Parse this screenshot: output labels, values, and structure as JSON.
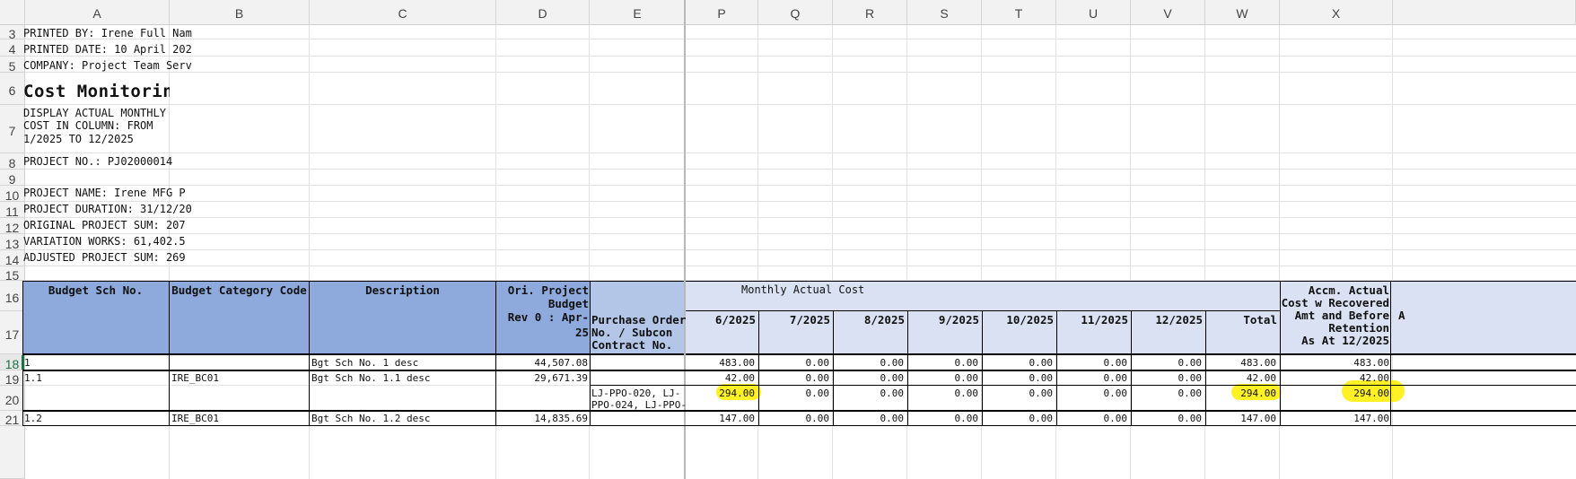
{
  "columns": [
    "A",
    "B",
    "C",
    "D",
    "E",
    "P",
    "Q",
    "R",
    "S",
    "T",
    "U",
    "V",
    "W",
    "X"
  ],
  "rows": [
    "3",
    "4",
    "5",
    "6",
    "7",
    "8",
    "9",
    "10",
    "11",
    "12",
    "13",
    "14",
    "15",
    "16",
    "17",
    "18",
    "19",
    "20",
    "21"
  ],
  "header_info": {
    "printed_by": "PRINTED BY: Irene Full Nam",
    "printed_date": "PRINTED DATE: 10 April 202",
    "company": "COMPANY: Project Team Serv",
    "report_title": "Cost Monitoring R",
    "display_line1": "DISPLAY ACTUAL MONTHLY",
    "display_line2": "COST IN COLUMN: FROM",
    "display_line3": "1/2025 TO 12/2025",
    "project_no": "PROJECT NO.: PJ02000014",
    "project_name": "PROJECT NAME:  Irene MFG P",
    "project_duration": "PROJECT DURATION: 31/12/20",
    "original_sum": "ORIGINAL PROJECT SUM:  207",
    "variation_works": "VARIATION WORKS:  61,402.5",
    "adjusted_sum": "ADJUSTED PROJECT SUM:  269"
  },
  "table_header": {
    "budget_sch_no": "Budget Sch No.",
    "budget_category_code": "Budget Category Code",
    "description": "Description",
    "ori_budget_l1": "Ori. Project",
    "ori_budget_l2": "Budget",
    "ori_budget_l3": "Rev 0 : Apr-25",
    "po_l1": "Purchase Order",
    "po_l2": "No. / Subcon",
    "po_l3": "Contract No.",
    "monthly_actual_cost": "Monthly Actual Cost",
    "months": [
      "6/2025",
      "7/2025",
      "8/2025",
      "9/2025",
      "10/2025",
      "11/2025",
      "12/2025",
      "Total"
    ],
    "accm_l1": "Accm. Actual",
    "accm_l2": "Cost w Recovered",
    "accm_l3": "Amt and Before",
    "accm_l4": "Retention",
    "accm_l5": "As At 12/2025",
    "cut_letter": "A"
  },
  "data_rows": [
    {
      "sch": "1",
      "code": "",
      "desc": "Bgt Sch No. 1 desc",
      "budget": "44,507.08",
      "po1": "",
      "po2": "",
      "vals": [
        "483.00",
        "0.00",
        "0.00",
        "0.00",
        "0.00",
        "0.00",
        "0.00",
        "483.00",
        "483.00"
      ]
    },
    {
      "sch": "1.1",
      "code": "IRE_BC01",
      "desc": "Bgt Sch No. 1.1 desc",
      "budget": "29,671.39",
      "po1": "",
      "po2": "",
      "vals": [
        "42.00",
        "0.00",
        "0.00",
        "0.00",
        "0.00",
        "0.00",
        "0.00",
        "42.00",
        "42.00"
      ]
    },
    {
      "sch": "",
      "code": "",
      "desc": "",
      "budget": "",
      "po1": "LJ-PPO-020, LJ-",
      "po2": "PPO-024, LJ-PPO-",
      "vals": [
        "294.00",
        "0.00",
        "0.00",
        "0.00",
        "0.00",
        "0.00",
        "0.00",
        "294.00",
        "294.00"
      ]
    },
    {
      "sch": "1.2",
      "code": "IRE_BC01",
      "desc": "Bgt Sch No. 1.2 desc",
      "budget": "14,835.69",
      "po1": "",
      "po2": "",
      "vals": [
        "147.00",
        "0.00",
        "0.00",
        "0.00",
        "0.00",
        "0.00",
        "0.00",
        "147.00",
        "147.00"
      ]
    }
  ],
  "colors": {
    "header_blue": "#8ea9db",
    "header_light": "#b4c6e7",
    "header_pale": "#d9e1f2",
    "highlight": "#ffee00"
  }
}
